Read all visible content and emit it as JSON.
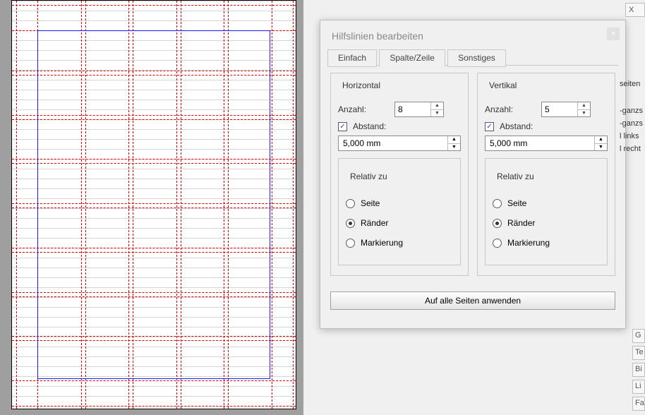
{
  "dialog": {
    "title": "Hilfslinien bearbeiten",
    "close_symbol": "×",
    "tabs": {
      "simple": "Einfach",
      "colrow": "Spalte/Zeile",
      "other": "Sonstiges"
    },
    "apply_label": "Auf alle Seiten anwenden"
  },
  "horizontal": {
    "group_label": "Horizontal",
    "count_label": "Anzahl:",
    "count_value": "8",
    "gap_label": "Abstand:",
    "gap_checked": true,
    "gap_value": "5,000 mm",
    "relative_group": "Relativ zu",
    "opt_page": "Seite",
    "opt_margins": "Ränder",
    "opt_selection": "Markierung",
    "relative_selected": "margins"
  },
  "vertical": {
    "group_label": "Vertikal",
    "count_label": "Anzahl:",
    "count_value": "5",
    "gap_label": "Abstand:",
    "gap_checked": true,
    "gap_value": "5,000 mm",
    "relative_group": "Relativ zu",
    "opt_page": "Seite",
    "opt_margins": "Ränder",
    "opt_selection": "Markierung",
    "relative_selected": "margins"
  },
  "right_strip": {
    "top_x": "X",
    "seiten": "seiten",
    "list": [
      "-ganzs",
      "-ganzs",
      "l links",
      "l recht"
    ],
    "bottom": [
      "G",
      "Te",
      "Bi",
      "Li",
      "Fa"
    ]
  }
}
